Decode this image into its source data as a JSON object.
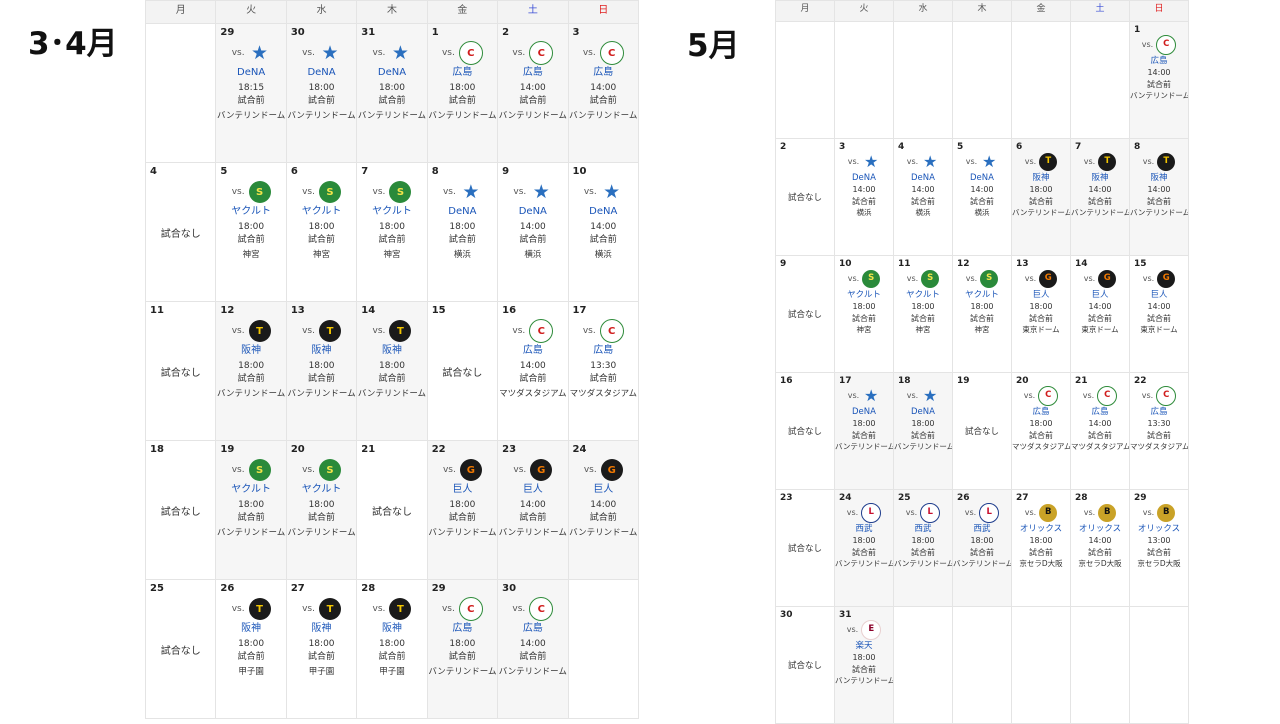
{
  "weekdays": [
    "月",
    "火",
    "水",
    "木",
    "金",
    "土",
    "日"
  ],
  "calendars": [
    {
      "title": "3･4月",
      "weeks": [
        [
          {
            "day": ""
          },
          {
            "day": "29",
            "team": "star",
            "opp": "DeNA",
            "time": "18:15",
            "status": "試合前",
            "venue": "バンテリンドーム"
          },
          {
            "day": "30",
            "team": "star",
            "opp": "DeNA",
            "time": "18:00",
            "status": "試合前",
            "venue": "バンテリンドーム"
          },
          {
            "day": "31",
            "team": "star",
            "opp": "DeNA",
            "time": "18:00",
            "status": "試合前",
            "venue": "バンテリンドーム"
          },
          {
            "day": "1",
            "team": "carp",
            "opp": "広島",
            "time": "18:00",
            "status": "試合前",
            "venue": "バンテリンドーム"
          },
          {
            "day": "2",
            "team": "carp",
            "opp": "広島",
            "time": "14:00",
            "status": "試合前",
            "venue": "バンテリンドーム"
          },
          {
            "day": "3",
            "team": "carp",
            "opp": "広島",
            "time": "14:00",
            "status": "試合前",
            "venue": "バンテリンドーム"
          }
        ],
        [
          {
            "day": "4",
            "nogame": "試合なし"
          },
          {
            "day": "5",
            "team": "swallows",
            "opp": "ヤクルト",
            "time": "18:00",
            "status": "試合前",
            "venue": "神宮"
          },
          {
            "day": "6",
            "team": "swallows",
            "opp": "ヤクルト",
            "time": "18:00",
            "status": "試合前",
            "venue": "神宮"
          },
          {
            "day": "7",
            "team": "swallows",
            "opp": "ヤクルト",
            "time": "18:00",
            "status": "試合前",
            "venue": "神宮"
          },
          {
            "day": "8",
            "team": "star",
            "opp": "DeNA",
            "time": "18:00",
            "status": "試合前",
            "venue": "横浜"
          },
          {
            "day": "9",
            "team": "star",
            "opp": "DeNA",
            "time": "14:00",
            "status": "試合前",
            "venue": "横浜"
          },
          {
            "day": "10",
            "team": "star",
            "opp": "DeNA",
            "time": "14:00",
            "status": "試合前",
            "venue": "横浜"
          }
        ],
        [
          {
            "day": "11",
            "nogame": "試合なし"
          },
          {
            "day": "12",
            "team": "tigers",
            "opp": "阪神",
            "time": "18:00",
            "status": "試合前",
            "venue": "バンテリンドーム"
          },
          {
            "day": "13",
            "team": "tigers",
            "opp": "阪神",
            "time": "18:00",
            "status": "試合前",
            "venue": "バンテリンドーム"
          },
          {
            "day": "14",
            "team": "tigers",
            "opp": "阪神",
            "time": "18:00",
            "status": "試合前",
            "venue": "バンテリンドーム"
          },
          {
            "day": "15",
            "nogame": "試合なし"
          },
          {
            "day": "16",
            "team": "carp",
            "opp": "広島",
            "time": "14:00",
            "status": "試合前",
            "venue": "マツダスタジアム"
          },
          {
            "day": "17",
            "team": "carp",
            "opp": "広島",
            "time": "13:30",
            "status": "試合前",
            "venue": "マツダスタジアム"
          }
        ],
        [
          {
            "day": "18",
            "nogame": "試合なし"
          },
          {
            "day": "19",
            "team": "swallows",
            "opp": "ヤクルト",
            "time": "18:00",
            "status": "試合前",
            "venue": "バンテリンドーム"
          },
          {
            "day": "20",
            "team": "swallows",
            "opp": "ヤクルト",
            "time": "18:00",
            "status": "試合前",
            "venue": "バンテリンドーム"
          },
          {
            "day": "21",
            "nogame": "試合なし"
          },
          {
            "day": "22",
            "team": "giants",
            "opp": "巨人",
            "time": "18:00",
            "status": "試合前",
            "venue": "バンテリンドーム"
          },
          {
            "day": "23",
            "team": "giants",
            "opp": "巨人",
            "time": "14:00",
            "status": "試合前",
            "venue": "バンテリンドーム"
          },
          {
            "day": "24",
            "team": "giants",
            "opp": "巨人",
            "time": "14:00",
            "status": "試合前",
            "venue": "バンテリンドーム"
          }
        ],
        [
          {
            "day": "25",
            "nogame": "試合なし"
          },
          {
            "day": "26",
            "team": "tigers",
            "opp": "阪神",
            "time": "18:00",
            "status": "試合前",
            "venue": "甲子園"
          },
          {
            "day": "27",
            "team": "tigers",
            "opp": "阪神",
            "time": "18:00",
            "status": "試合前",
            "venue": "甲子園"
          },
          {
            "day": "28",
            "team": "tigers",
            "opp": "阪神",
            "time": "18:00",
            "status": "試合前",
            "venue": "甲子園"
          },
          {
            "day": "29",
            "team": "carp",
            "opp": "広島",
            "time": "18:00",
            "status": "試合前",
            "venue": "バンテリンドーム"
          },
          {
            "day": "30",
            "team": "carp",
            "opp": "広島",
            "time": "14:00",
            "status": "試合前",
            "venue": "バンテリンドーム"
          },
          {
            "day": ""
          }
        ]
      ]
    },
    {
      "title": "5月",
      "weeks": [
        [
          {
            "day": ""
          },
          {
            "day": ""
          },
          {
            "day": ""
          },
          {
            "day": ""
          },
          {
            "day": ""
          },
          {
            "day": ""
          },
          {
            "day": "1",
            "team": "carp",
            "opp": "広島",
            "time": "14:00",
            "status": "試合前",
            "venue": "バンテリンドーム"
          }
        ],
        [
          {
            "day": "2",
            "nogame": "試合なし"
          },
          {
            "day": "3",
            "team": "star",
            "opp": "DeNA",
            "time": "14:00",
            "status": "試合前",
            "venue": "横浜"
          },
          {
            "day": "4",
            "team": "star",
            "opp": "DeNA",
            "time": "14:00",
            "status": "試合前",
            "venue": "横浜"
          },
          {
            "day": "5",
            "team": "star",
            "opp": "DeNA",
            "time": "14:00",
            "status": "試合前",
            "venue": "横浜"
          },
          {
            "day": "6",
            "team": "tigers",
            "opp": "阪神",
            "time": "18:00",
            "status": "試合前",
            "venue": "バンテリンドーム"
          },
          {
            "day": "7",
            "team": "tigers",
            "opp": "阪神",
            "time": "14:00",
            "status": "試合前",
            "venue": "バンテリンドーム"
          },
          {
            "day": "8",
            "team": "tigers",
            "opp": "阪神",
            "time": "14:00",
            "status": "試合前",
            "venue": "バンテリンドーム"
          }
        ],
        [
          {
            "day": "9",
            "nogame": "試合なし"
          },
          {
            "day": "10",
            "team": "swallows",
            "opp": "ヤクルト",
            "time": "18:00",
            "status": "試合前",
            "venue": "神宮"
          },
          {
            "day": "11",
            "team": "swallows",
            "opp": "ヤクルト",
            "time": "18:00",
            "status": "試合前",
            "venue": "神宮"
          },
          {
            "day": "12",
            "team": "swallows",
            "opp": "ヤクルト",
            "time": "18:00",
            "status": "試合前",
            "venue": "神宮"
          },
          {
            "day": "13",
            "team": "giants",
            "opp": "巨人",
            "time": "18:00",
            "status": "試合前",
            "venue": "東京ドーム"
          },
          {
            "day": "14",
            "team": "giants",
            "opp": "巨人",
            "time": "14:00",
            "status": "試合前",
            "venue": "東京ドーム"
          },
          {
            "day": "15",
            "team": "giants",
            "opp": "巨人",
            "time": "14:00",
            "status": "試合前",
            "venue": "東京ドーム"
          }
        ],
        [
          {
            "day": "16",
            "nogame": "試合なし"
          },
          {
            "day": "17",
            "team": "star",
            "opp": "DeNA",
            "time": "18:00",
            "status": "試合前",
            "venue": "バンテリンドーム"
          },
          {
            "day": "18",
            "team": "star",
            "opp": "DeNA",
            "time": "18:00",
            "status": "試合前",
            "venue": "バンテリンドーム"
          },
          {
            "day": "19",
            "nogame": "試合なし"
          },
          {
            "day": "20",
            "team": "carp",
            "opp": "広島",
            "time": "18:00",
            "status": "試合前",
            "venue": "マツダスタジアム"
          },
          {
            "day": "21",
            "team": "carp",
            "opp": "広島",
            "time": "14:00",
            "status": "試合前",
            "venue": "マツダスタジアム"
          },
          {
            "day": "22",
            "team": "carp",
            "opp": "広島",
            "time": "13:30",
            "status": "試合前",
            "venue": "マツダスタジアム"
          }
        ],
        [
          {
            "day": "23",
            "nogame": "試合なし"
          },
          {
            "day": "24",
            "team": "lions",
            "opp": "西武",
            "time": "18:00",
            "status": "試合前",
            "venue": "バンテリンドーム"
          },
          {
            "day": "25",
            "team": "lions",
            "opp": "西武",
            "time": "18:00",
            "status": "試合前",
            "venue": "バンテリンドーム"
          },
          {
            "day": "26",
            "team": "lions",
            "opp": "西武",
            "time": "18:00",
            "status": "試合前",
            "venue": "バンテリンドーム"
          },
          {
            "day": "27",
            "team": "buffaloes",
            "opp": "オリックス",
            "time": "18:00",
            "status": "試合前",
            "venue": "京セラD大阪"
          },
          {
            "day": "28",
            "team": "buffaloes",
            "opp": "オリックス",
            "time": "14:00",
            "status": "試合前",
            "venue": "京セラD大阪"
          },
          {
            "day": "29",
            "team": "buffaloes",
            "opp": "オリックス",
            "time": "13:00",
            "status": "試合前",
            "venue": "京セラD大阪"
          }
        ],
        [
          {
            "day": "30",
            "nogame": "試合なし"
          },
          {
            "day": "31",
            "team": "eagles",
            "opp": "楽天",
            "time": "18:00",
            "status": "試合前",
            "venue": "バンテリンドーム"
          },
          {
            "day": ""
          },
          {
            "day": ""
          },
          {
            "day": ""
          },
          {
            "day": ""
          },
          {
            "day": ""
          }
        ]
      ]
    }
  ],
  "vs_label": "vs.",
  "team_glyphs": {
    "star": "★",
    "carp": "C",
    "tigers": "T",
    "giants": "G",
    "swallows": "S",
    "lions": "L",
    "buffaloes": "B",
    "eagles": "E"
  },
  "colors": {
    "saturday": "#3b4fd6",
    "sunday": "#e02020",
    "opponent_link": "#1a55b8",
    "home_shade": "#f6f6f6"
  }
}
